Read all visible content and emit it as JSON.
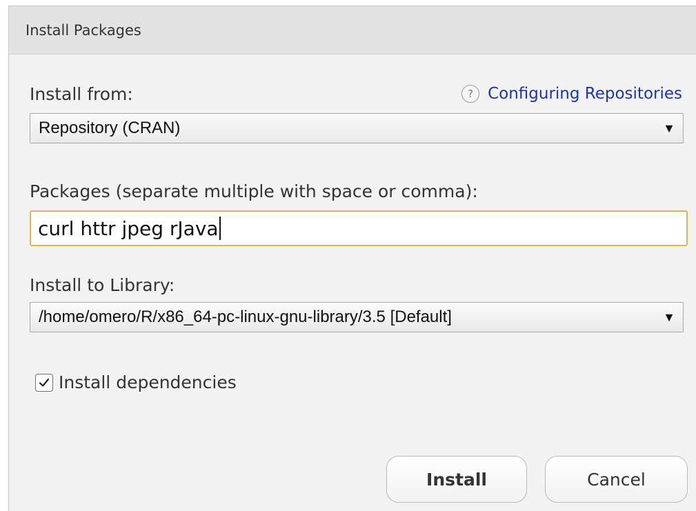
{
  "dialog": {
    "title": "Install Packages"
  },
  "install_from": {
    "label": "Install from:",
    "help_icon": "question-circle-icon",
    "help_link": "Configuring Repositories",
    "selected": "Repository (CRAN)"
  },
  "packages": {
    "label": "Packages (separate multiple with space or comma):",
    "value": "curl httr jpeg rJava"
  },
  "library": {
    "label": "Install to Library:",
    "selected": "/home/omero/R/x86_64-pc-linux-gnu-library/3.5 [Default]"
  },
  "dependencies": {
    "label": "Install dependencies",
    "checked": true,
    "icon": "checkmark-icon"
  },
  "dropdown_icon": "triangle-down-icon",
  "buttons": {
    "install": "Install",
    "cancel": "Cancel"
  },
  "colors": {
    "link": "#1e35a6",
    "focus_border": "#e6b24a",
    "dialog_background": "#f2f2f2",
    "titlebar_background": "#e2e2e2"
  }
}
